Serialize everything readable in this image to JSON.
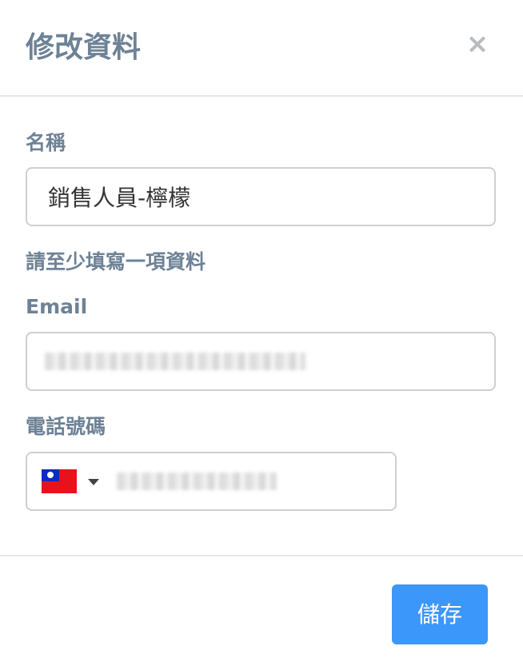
{
  "dialog": {
    "title": "修改資料",
    "close_symbol": "×"
  },
  "form": {
    "name_label": "名稱",
    "name_value": "銷售人員-檸檬",
    "hint": "請至少填寫一項資料",
    "email_label": "Email",
    "email_value": "",
    "phone_label": "電話號碼",
    "phone_country_flag": "taiwan-flag-icon",
    "phone_value": ""
  },
  "footer": {
    "save_label": "儲存"
  },
  "colors": {
    "label_text": "#6e8296",
    "primary_button": "#3c97fa",
    "border": "#cfcfcf",
    "divider": "#e5e7eb"
  }
}
